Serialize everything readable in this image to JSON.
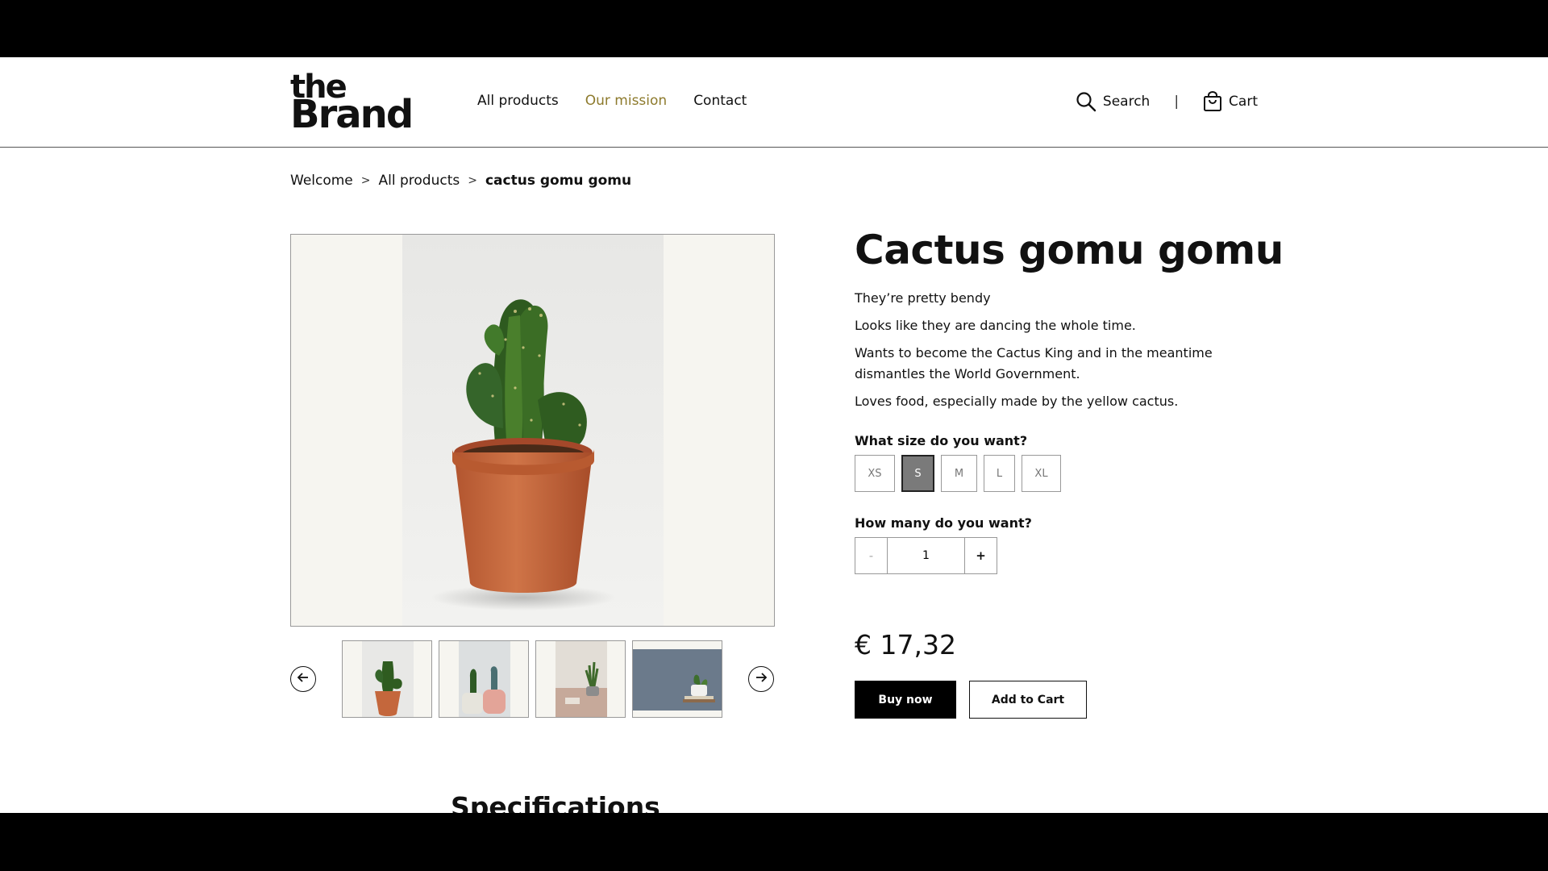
{
  "header": {
    "logo": {
      "line1": "the",
      "line2": "Brand"
    },
    "nav": [
      {
        "label": "All products",
        "active": false
      },
      {
        "label": "Our mission",
        "active": true
      },
      {
        "label": "Contact",
        "active": false
      }
    ],
    "search_label": "Search",
    "separator": "|",
    "cart_label": "Cart",
    "active_color": "#8d7a2c"
  },
  "breadcrumb": {
    "items": [
      "Welcome",
      "All products",
      "cactus gomu gomu"
    ],
    "separator": ">"
  },
  "gallery": {
    "main_image": "cactus-in-terracotta-pot-photo",
    "thumbnails": [
      {
        "name": "cactus-terracotta-thumb"
      },
      {
        "name": "cacti-pink-pots-thumb"
      },
      {
        "name": "plant-in-room-thumb"
      },
      {
        "name": "plant-on-books-thumb"
      }
    ],
    "prev_icon": "arrow-left-circle-icon",
    "next_icon": "arrow-right-circle-icon"
  },
  "product": {
    "title": "Cactus gomu gomu",
    "description": [
      "They’re pretty bendy",
      "Looks like they are dancing the whole time.",
      "Wants to become the Cactus King and in the meantime dismantles the World Government.",
      "Loves food, especially made by the yellow cactus."
    ],
    "size_label": "What size do you want?",
    "sizes": [
      "XS",
      "S",
      "M",
      "L",
      "XL"
    ],
    "selected_size": "S",
    "quantity_label": "How many do you want?",
    "quantity": "1",
    "minus": "-",
    "plus": "+",
    "price": "€ 17,32",
    "buy_now": "Buy now",
    "add_to_cart": "Add to Cart"
  },
  "specifications_heading": "Specifications"
}
